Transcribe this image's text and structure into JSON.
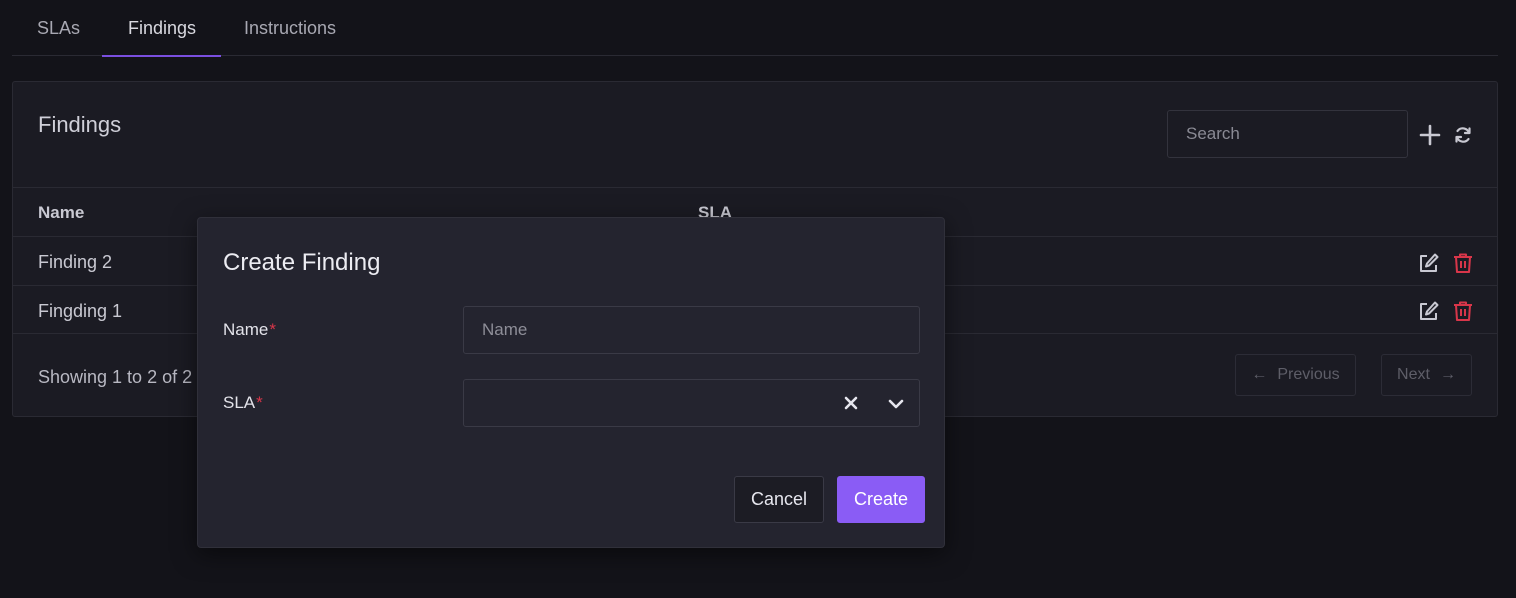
{
  "tabs": [
    {
      "label": "SLAs",
      "active": false
    },
    {
      "label": "Findings",
      "active": true
    },
    {
      "label": "Instructions",
      "active": false
    }
  ],
  "card": {
    "title": "Findings",
    "search_placeholder": "Search",
    "add_icon": "plus-icon",
    "refresh_icon": "refresh-icon"
  },
  "table": {
    "columns": [
      "Name",
      "SLA"
    ],
    "rows": [
      {
        "name": "Finding 2",
        "sla": ""
      },
      {
        "name": "Fingding 1",
        "sla": ""
      }
    ],
    "row_actions": [
      "edit-icon",
      "trash-icon"
    ]
  },
  "pagination": {
    "summary": "Showing 1 to 2 of 2",
    "previous_label": "Previous",
    "next_label": "Next",
    "prev_arrow": "←",
    "next_arrow": "→"
  },
  "modal": {
    "title": "Create Finding",
    "name_label": "Name",
    "name_placeholder": "Name",
    "name_value": "",
    "sla_label": "SLA",
    "sla_value": "",
    "required_marker": "*",
    "cancel_label": "Cancel",
    "create_label": "Create"
  },
  "colors": {
    "background": "#131319",
    "card": "#1b1b23",
    "modal": "#24242f",
    "accent": "#8a5cf5",
    "danger": "#d9364a",
    "tab_underline": "#7a4fe0"
  }
}
